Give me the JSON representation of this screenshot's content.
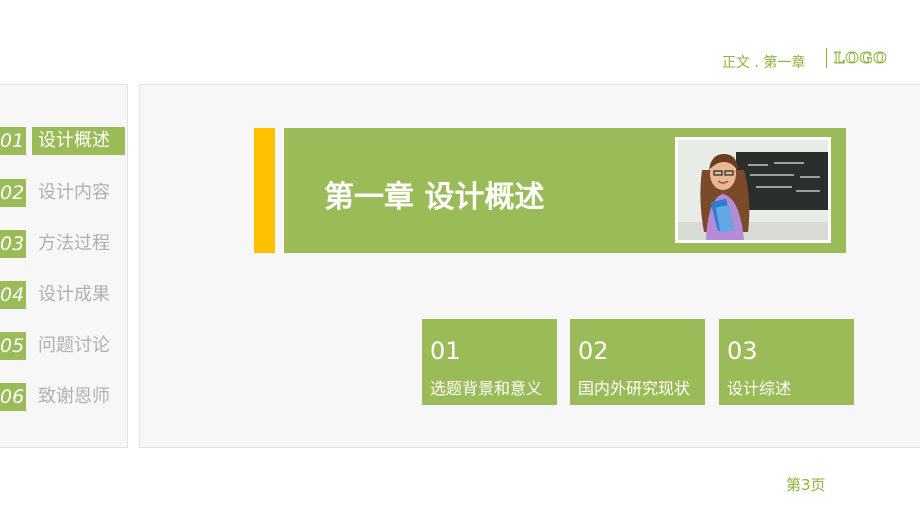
{
  "header": {
    "breadcrumb": "正文 . 第一章",
    "logo": "LOGO"
  },
  "sidebar": {
    "items": [
      {
        "num": "01",
        "label": "设计概述",
        "active": true
      },
      {
        "num": "02",
        "label": "设计内容",
        "active": false
      },
      {
        "num": "03",
        "label": "方法过程",
        "active": false
      },
      {
        "num": "04",
        "label": "设计成果",
        "active": false
      },
      {
        "num": "05",
        "label": "问题讨论",
        "active": false
      },
      {
        "num": "06",
        "label": "致谢恩师",
        "active": false
      }
    ]
  },
  "chapter": {
    "title": "第一章  设计概述"
  },
  "cards": [
    {
      "num": "01",
      "label": "选题背景和意义"
    },
    {
      "num": "02",
      "label": "国内外研究现状"
    },
    {
      "num": "03",
      "label": "设计综述"
    }
  ],
  "footer": {
    "page": "第3页"
  },
  "colors": {
    "accent_green": "#9bbb59",
    "accent_yellow": "#ffc000",
    "text_green": "#8db53a"
  }
}
